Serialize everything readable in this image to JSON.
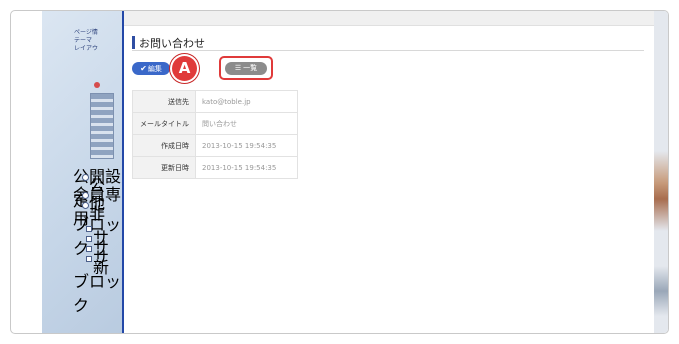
{
  "sidebar": {
    "items": [
      "ページ情",
      "テーマ",
      "レイアウ"
    ],
    "section_labels": [
      "公開設定",
      "会員専用",
      "ブロック",
      "ブロック"
    ],
    "radio_labels": [
      "公",
      "他",
      "非"
    ],
    "checkbox_labels": [
      "サ",
      "サ",
      "サ",
      "新"
    ]
  },
  "modal": {
    "title": "お問い合わせ",
    "edit_button": "編集",
    "list_button": "一覧",
    "callout_label": "A",
    "fields": [
      {
        "label": "送信先",
        "value": "kato@toble.jp"
      },
      {
        "label": "メールタイトル",
        "value": "問い合わせ"
      },
      {
        "label": "作成日時",
        "value": "2013-10-15 19:54:35"
      },
      {
        "label": "更新日時",
        "value": "2013-10-15 19:54:35"
      }
    ]
  },
  "colors": {
    "accent": "#2348a8",
    "edit_button": "#3a68c9",
    "list_button": "#8c8c8c",
    "callout": "#e03a3a"
  }
}
